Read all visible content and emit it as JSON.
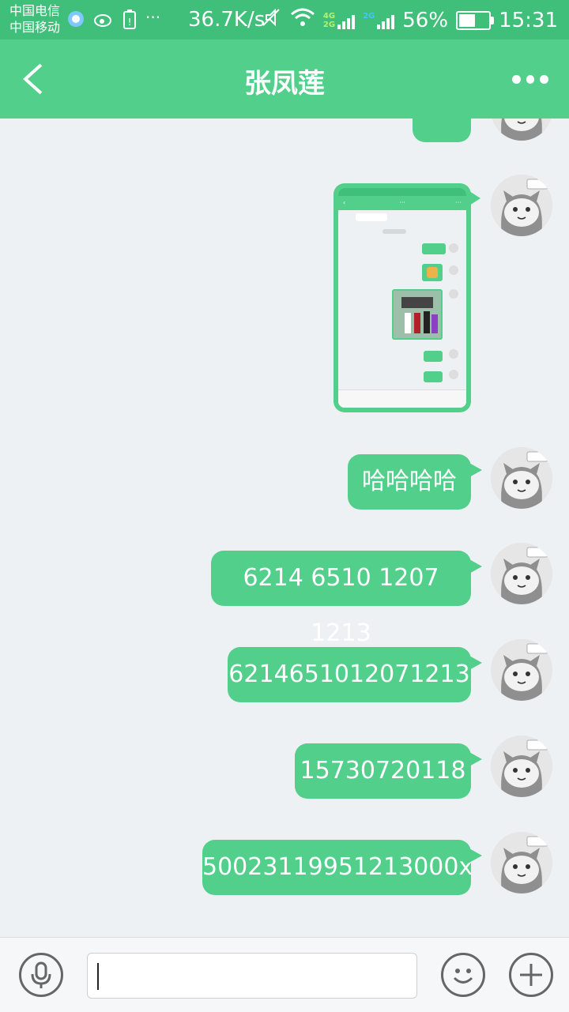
{
  "status_bar": {
    "carrier_1": "中国电信",
    "carrier_2": "中国移动",
    "net_speed": "36.7K/s",
    "net_4g": "4G",
    "net_2g_a": "2G",
    "net_2g_b": "2G",
    "battery_percent": "56%",
    "battery_level": 0.56,
    "time": "15:31",
    "icons": [
      "browser-icon",
      "weibo-icon",
      "battery-alert-icon",
      "more-dots-icon",
      "mute-icon",
      "wifi-icon",
      "signal-icon"
    ]
  },
  "header": {
    "title": "张凤莲",
    "back_icon": "chevron-left-icon",
    "more_icon": "more-horizontal-icon"
  },
  "messages": [
    {
      "type": "text",
      "text": "",
      "partial": true
    },
    {
      "type": "image",
      "content": "chat-screenshot"
    },
    {
      "type": "text",
      "text": "哈哈哈哈"
    },
    {
      "type": "text",
      "text": "6214 6510 1207 1213"
    },
    {
      "type": "text",
      "text": "6214651012071213"
    },
    {
      "type": "text",
      "text": "15730720118"
    },
    {
      "type": "text",
      "text": "50023119951213000x"
    }
  ],
  "input_bar": {
    "voice_icon": "microphone-icon",
    "text_value": "",
    "emoji_icon": "smiley-icon",
    "plus_icon": "plus-icon"
  },
  "colors": {
    "accent": "#52cf8b",
    "status_bar": "#3fbf7a",
    "background": "#eef1f4"
  }
}
